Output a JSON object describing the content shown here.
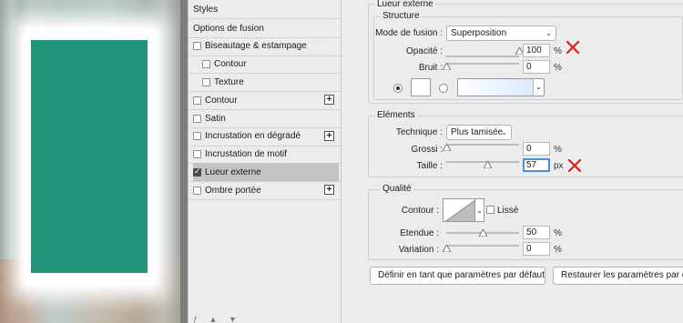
{
  "styles_list": {
    "header": "Styles",
    "items": [
      {
        "label": "Options de fusion",
        "checkbox": false,
        "checked": false,
        "indent": false,
        "plus": false,
        "selected": false
      },
      {
        "label": "Biseautage & estampage",
        "checkbox": true,
        "checked": false,
        "indent": false,
        "plus": false,
        "selected": false
      },
      {
        "label": "Contour",
        "checkbox": true,
        "checked": false,
        "indent": true,
        "plus": false,
        "selected": false
      },
      {
        "label": "Texture",
        "checkbox": true,
        "checked": false,
        "indent": true,
        "plus": false,
        "selected": false
      },
      {
        "label": "Contour",
        "checkbox": true,
        "checked": false,
        "indent": false,
        "plus": true,
        "selected": false
      },
      {
        "label": "Satin",
        "checkbox": true,
        "checked": false,
        "indent": false,
        "plus": false,
        "selected": false
      },
      {
        "label": "Incrustation en dégradé",
        "checkbox": true,
        "checked": false,
        "indent": false,
        "plus": true,
        "selected": false
      },
      {
        "label": "Incrustation de motif",
        "checkbox": true,
        "checked": false,
        "indent": false,
        "plus": false,
        "selected": false
      },
      {
        "label": "Lueur externe",
        "checkbox": true,
        "checked": true,
        "indent": false,
        "plus": false,
        "selected": true
      },
      {
        "label": "Ombre portée",
        "checkbox": true,
        "checked": false,
        "indent": false,
        "plus": true,
        "selected": false
      }
    ]
  },
  "panel": {
    "title": "Lueur externe",
    "structure": {
      "legend": "Structure",
      "blend_mode_label": "Mode de fusion :",
      "blend_mode_value": "Superposition",
      "opacity_label": "Opacité :",
      "opacity_value": "100",
      "opacity_unit": "%",
      "noise_label": "Bruit :",
      "noise_value": "0",
      "noise_unit": "%"
    },
    "elements": {
      "legend": "Eléments",
      "technique_label": "Technique :",
      "technique_value": "Plus tamisée",
      "spread_label": "Grossi :",
      "spread_value": "0",
      "spread_unit": "%",
      "size_label": "Taille :",
      "size_value": "57",
      "size_unit": "px"
    },
    "quality": {
      "legend": "Qualité",
      "contour_label": "Contour :",
      "antialias_label": "Lissé",
      "range_label": "Etendue :",
      "range_value": "50",
      "range_unit": "%",
      "jitter_label": "Variation :",
      "jitter_value": "0",
      "jitter_unit": "%"
    },
    "buttons": {
      "make_default": "Définir en tant que paramètres par défaut",
      "reset_default": "Restaurer les paramètres par défaut"
    }
  },
  "colors": {
    "canvas_fill": "#24957c",
    "selected_row": "#c4c4c4",
    "annotation": "#e01e1e",
    "focus": "#4d8fd8"
  },
  "sliders": {
    "opacity": 100,
    "noise": 0,
    "spread": 0,
    "size": 57,
    "range": 50,
    "jitter": 0
  }
}
